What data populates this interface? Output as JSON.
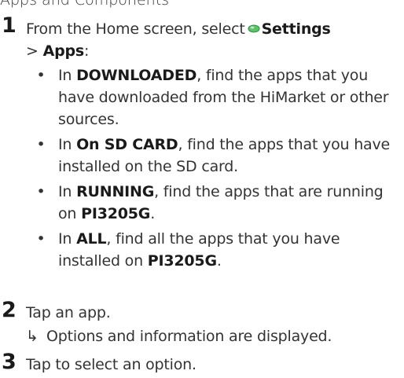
{
  "clipped_heading": "Apps and Components",
  "steps": [
    {
      "number": "1",
      "text_prefix": "From the Home screen, select",
      "settings_label": "Settings",
      "separator": ">",
      "apps_label": "Apps",
      "suffix": ":",
      "bullets": [
        {
          "lead": "In",
          "tab": "DOWNLOADED",
          "rest": ", find the apps that you have downloaded from the HiMarket or other sources."
        },
        {
          "lead": "In",
          "tab": "On SD CARD",
          "rest": ", find the apps that you have installed on the SD card."
        },
        {
          "lead": "In",
          "tab": "RUNNING",
          "rest": ", find the apps that are running on",
          "device": "PI3205G",
          "end": "."
        },
        {
          "lead": "In",
          "tab": "ALL",
          "rest": ", find all the apps that you have installed on",
          "device": "PI3205G",
          "end": "."
        }
      ]
    },
    {
      "number": "2",
      "text": "Tap an app.",
      "result_arrow": "↳",
      "result": "Options and information are displayed."
    },
    {
      "number": "3",
      "text": "Tap to select an option."
    }
  ],
  "bullet_glyph": "•",
  "colors": {
    "settings_icon_fill": "#5cc26a",
    "settings_icon_outline": "#2f8a3e",
    "text": "#333333"
  },
  "icons": {
    "settings": "settings-icon"
  }
}
